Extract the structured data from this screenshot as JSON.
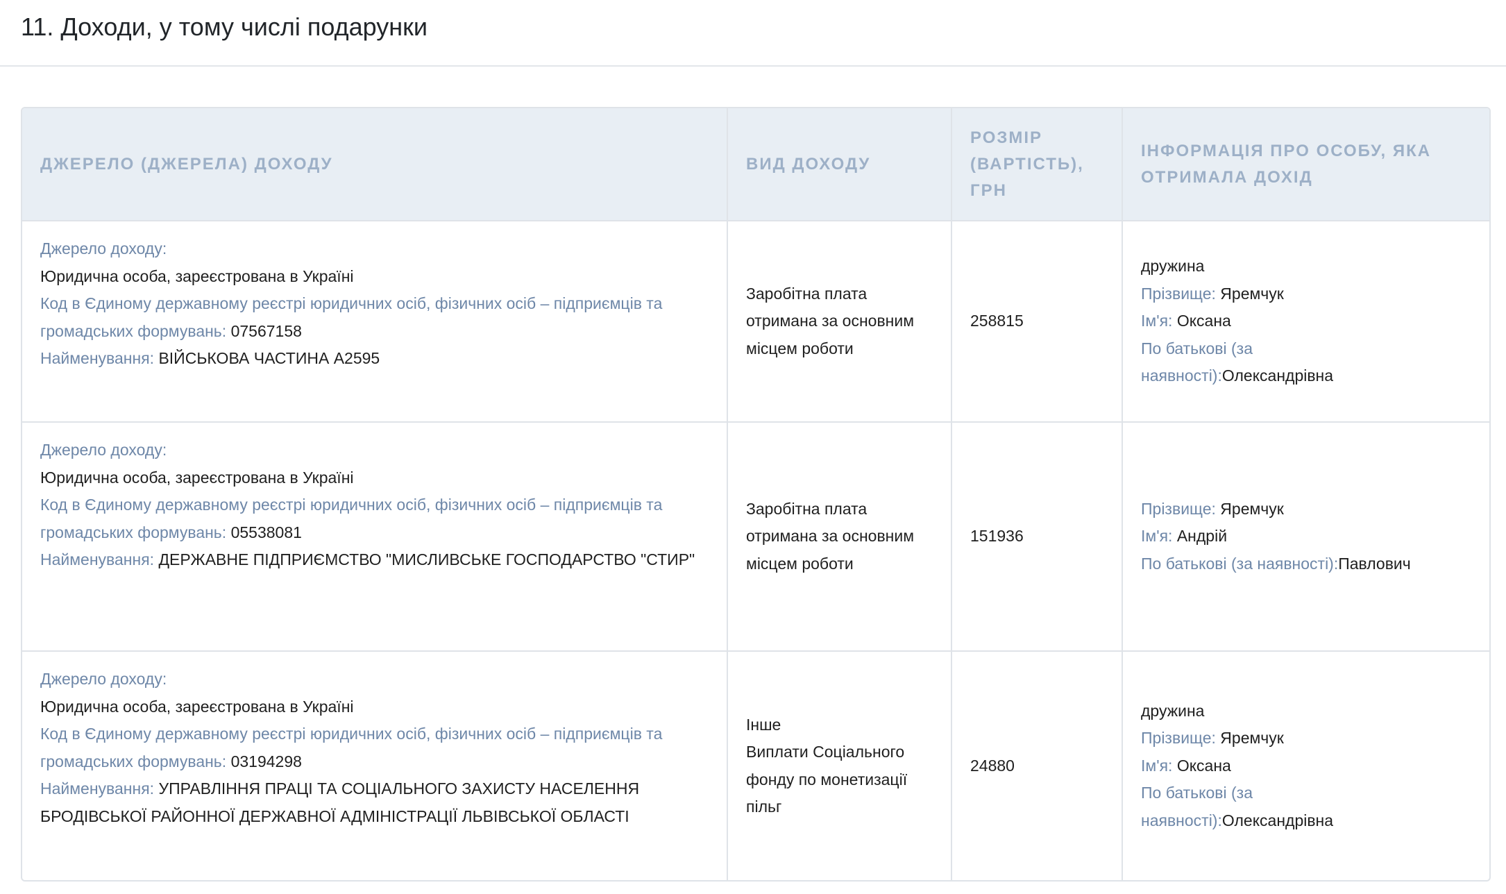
{
  "section_title": "11. Доходи, у тому числі подарунки",
  "table": {
    "headers": {
      "source": "Джерело (джерела) доходу",
      "type": "Вид доходу",
      "amount": "Розмір (вартість), грн",
      "person": "Інформація про особу, яка отримала дохід"
    },
    "labels": {
      "source": "Джерело доходу:",
      "code": "Код в Єдиному державному реєстрі юридичних осіб, фізичних осіб – підприємців та громадських формувань:",
      "name": "Найменування:",
      "surname": "Прізвище:",
      "first_name": "Ім'я:",
      "patronymic": "По батькові (за наявності):"
    },
    "rows": [
      {
        "source_type": "Юридична особа, зареєстрована в Україні",
        "code": "07567158",
        "name": "ВІЙСЬКОВА ЧАСТИНА А2595",
        "income_type": "Заробітна плата отримана за основним місцем роботи",
        "amount": "258815",
        "relation": "дружина",
        "surname": "Яремчук",
        "first_name": "Оксана",
        "patronymic": "Олександрівна"
      },
      {
        "source_type": "Юридична особа, зареєстрована в Україні",
        "code": "05538081",
        "name": "ДЕРЖАВНЕ ПІДПРИЄМСТВО \"МИСЛИВСЬКЕ ГОСПОДАРСТВО \"СТИР\"",
        "income_type": "Заробітна плата отримана за основним місцем роботи",
        "amount": "151936",
        "relation": "",
        "surname": "Яремчук",
        "first_name": "Андрій",
        "patronymic": "Павлович"
      },
      {
        "source_type": "Юридична особа, зареєстрована в Україні",
        "code": "03194298",
        "name": "УПРАВЛІННЯ ПРАЦІ ТА СОЦІАЛЬНОГО ЗАХИСТУ НАСЕЛЕННЯ БРОДІВСЬКОЇ РАЙОННОЇ ДЕРЖАВНОЇ АДМІНІСТРАЦІЇ ЛЬВІВСЬКОЇ ОБЛАСТІ",
        "income_type_line1": "Інше",
        "income_type": "Виплати Соціального фонду по монетизації пільг",
        "amount": "24880",
        "relation": "дружина",
        "surname": "Яремчук",
        "first_name": "Оксана",
        "patronymic": "Олександрівна"
      }
    ]
  }
}
